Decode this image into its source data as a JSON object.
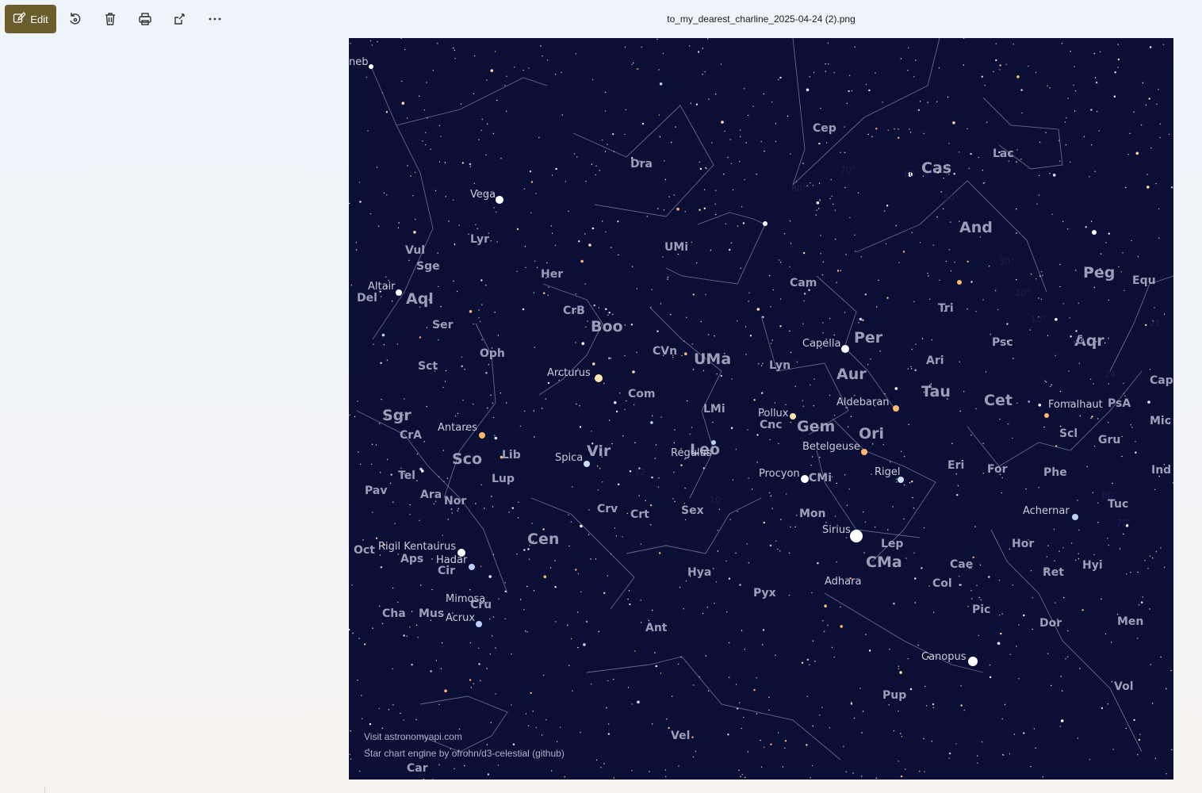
{
  "toolbar": {
    "edit_label": "Edit",
    "icons": [
      "rotate-icon",
      "delete-icon",
      "print-icon",
      "share-icon",
      "more-icon"
    ],
    "accent": "#6b5c2e"
  },
  "file": {
    "name": "to_my_dearest_charline_2025-04-24 (2).png"
  },
  "starchart": {
    "background": "#0b0f36",
    "credit_line1": "Visit astronomyapi.com",
    "credit_line2": "Star chart engine by ofrohn/d3-celestial (github)",
    "constellations": [
      "Dra",
      "Cep",
      "Cas",
      "Lac",
      "UMi",
      "And",
      "Lyr",
      "Vul",
      "Sge",
      "Her",
      "Cam",
      "Peg",
      "Equ",
      "Del",
      "Aql",
      "Ser",
      "CrB",
      "Boo",
      "Tri",
      "Per",
      "Ari",
      "Psc",
      "Aqr",
      "Oph",
      "CVn",
      "UMa",
      "Lyn",
      "Aur",
      "Sct",
      "Com",
      "Tau",
      "Cet",
      "Cap",
      "Sgr",
      "LMi",
      "Cnc",
      "Gem",
      "PsA",
      "Mic",
      "CrA",
      "Sco",
      "Lib",
      "Vir",
      "Leo",
      "Ori",
      "Scl",
      "Gru",
      "Tel",
      "Eri",
      "For",
      "Phe",
      "Ind",
      "Pav",
      "Lup",
      "CMi",
      "Ara",
      "Nor",
      "Crv",
      "Crt",
      "Sex",
      "Mon",
      "Tuc",
      "Lep",
      "Oct",
      "Aps",
      "Cir",
      "Cen",
      "Hya",
      "CMa",
      "Hor",
      "Hyi",
      "Ret",
      "Cae",
      "Pyx",
      "Col",
      "Cha",
      "Mus",
      "Cru",
      "Pic",
      "Men",
      "Dor",
      "Ant",
      "Vol",
      "Pup",
      "Vel",
      "Car"
    ],
    "stars": [
      "Vega",
      "Altair",
      "Arcturus",
      "Capella",
      "Aldebaran",
      "Pollux",
      "Betelgeuse",
      "Antares",
      "Spica",
      "Regulus",
      "Procyon",
      "Fomalhaut",
      "Achernar",
      "Sirius",
      "Rigil Kentaurus",
      "Hadar",
      "Adhara",
      "Mimosa",
      "Acrux",
      "Canopus",
      "Rigel"
    ],
    "partial_label": "neb",
    "declination_labels": [
      "80°",
      "70°",
      "60°",
      "50°",
      "30°",
      "20°",
      "10°",
      "21",
      "23",
      "24",
      "12",
      "10",
      "60°",
      "70°"
    ]
  }
}
